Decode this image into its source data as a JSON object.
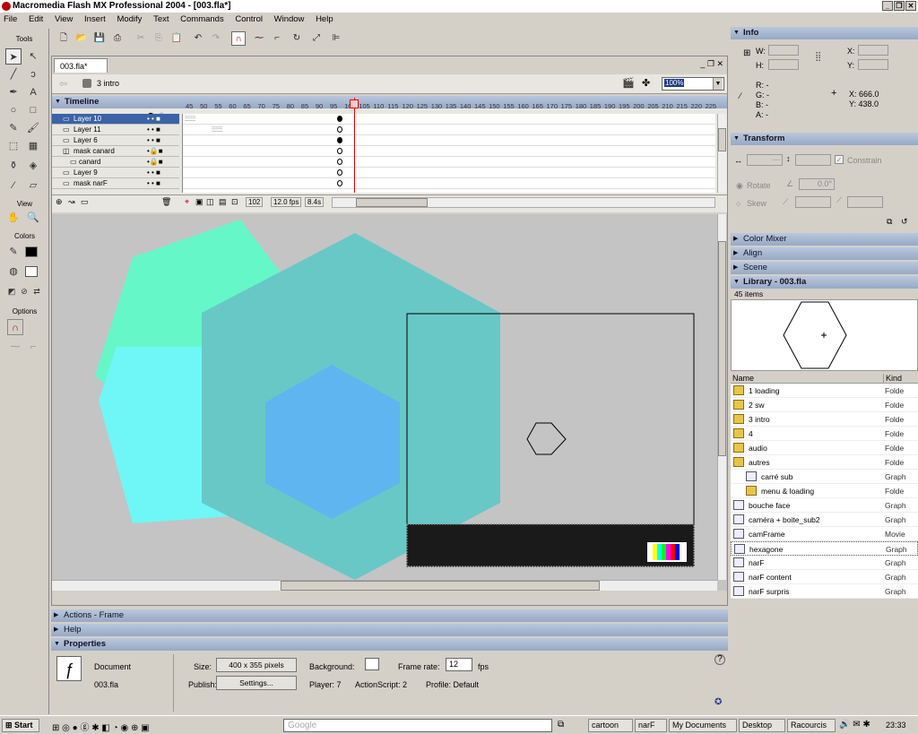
{
  "window": {
    "title": "Macromedia Flash MX Professional 2004 - [003.fla*]"
  },
  "menu": [
    "File",
    "Edit",
    "View",
    "Insert",
    "Modify",
    "Text",
    "Commands",
    "Control",
    "Window",
    "Help"
  ],
  "toolbox": {
    "tools_label": "Tools",
    "view_label": "View",
    "colors_label": "Colors",
    "options_label": "Options"
  },
  "document": {
    "tab": "003.fla*",
    "scene": "3 intro",
    "zoom": "100%"
  },
  "timeline": {
    "title": "Timeline",
    "ruler": [
      "45",
      "50",
      "55",
      "60",
      "65",
      "70",
      "75",
      "80",
      "85",
      "90",
      "95",
      "100",
      "105",
      "110",
      "115",
      "120",
      "125",
      "130",
      "135",
      "140",
      "145",
      "150",
      "155",
      "160",
      "165",
      "170",
      "175",
      "180",
      "185",
      "190",
      "195",
      "200",
      "205",
      "210",
      "215",
      "220",
      "225"
    ],
    "layers": [
      {
        "name": "Layer 10"
      },
      {
        "name": "Layer 11"
      },
      {
        "name": "Layer 6"
      },
      {
        "name": "mask canard"
      },
      {
        "name": "canard"
      },
      {
        "name": "Layer 9"
      },
      {
        "name": "mask narF"
      }
    ],
    "current_frame": "102",
    "fps": "12.0 fps",
    "time": "8.4s"
  },
  "panels": {
    "actions": "Actions - Frame",
    "help": "Help",
    "properties": "Properties"
  },
  "properties": {
    "doc_label": "Document",
    "doc_name": "003.fla",
    "size_label": "Size:",
    "size_value": "400 x 355 pixels",
    "publish_label": "Publish:",
    "settings_btn": "Settings...",
    "bg_label": "Background:",
    "framerate_label": "Frame rate:",
    "framerate_value": "12",
    "fps_unit": "fps",
    "player": "Player: 7",
    "actionscript": "ActionScript: 2",
    "profile": "Profile: Default"
  },
  "right": {
    "info": "Info",
    "w": "W:",
    "h": "H:",
    "x": "X:",
    "y": "Y:",
    "r": "R: -",
    "g": "G: -",
    "b": "B: -",
    "a": "A: -",
    "cx": "X: 666.0",
    "cy": "Y: 438.0",
    "transform": "Transform",
    "constrain": "Constrain",
    "rotate": "Rotate",
    "rotate_val": "0.0°",
    "skew": "Skew",
    "color_mixer": "Color Mixer",
    "align": "Align",
    "scene": "Scene",
    "library": "Library - 003.fla",
    "items": "45 items",
    "col_name": "Name",
    "col_kind": "Kind",
    "lib_items": [
      {
        "name": "1 loading",
        "kind": "Folde",
        "type": "folder"
      },
      {
        "name": "2 sw",
        "kind": "Folde",
        "type": "folder"
      },
      {
        "name": "3 intro",
        "kind": "Folde",
        "type": "folder"
      },
      {
        "name": "4",
        "kind": "Folde",
        "type": "folder"
      },
      {
        "name": "audio",
        "kind": "Folde",
        "type": "folder"
      },
      {
        "name": "autres",
        "kind": "Folde",
        "type": "folder"
      },
      {
        "name": "carré sub",
        "kind": "Graph",
        "type": "graphic",
        "indent": true
      },
      {
        "name": "menu & loading",
        "kind": "Folde",
        "type": "folder",
        "indent": true
      },
      {
        "name": "bouche face",
        "kind": "Graph",
        "type": "graphic"
      },
      {
        "name": "caméra + boite_sub2",
        "kind": "Graph",
        "type": "graphic"
      },
      {
        "name": "camFrame",
        "kind": "Movie",
        "type": "graphic"
      },
      {
        "name": "hexagone",
        "kind": "Graph",
        "type": "graphic"
      },
      {
        "name": "narF",
        "kind": "Graph",
        "type": "graphic"
      },
      {
        "name": "narF content",
        "kind": "Graph",
        "type": "graphic"
      },
      {
        "name": "narF surpris",
        "kind": "Graph",
        "type": "graphic"
      }
    ]
  },
  "taskbar": {
    "start": "Start",
    "search": "Google",
    "tasks": [
      "cartoon",
      "narF",
      "My Documents",
      "Desktop",
      "Racourcis"
    ],
    "clock": "23:33"
  }
}
